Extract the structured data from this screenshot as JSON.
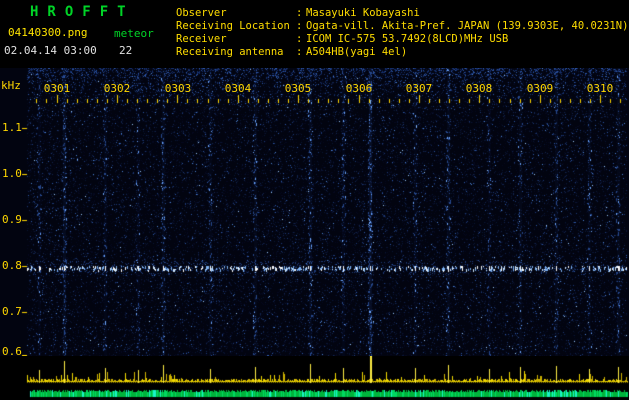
{
  "header": {
    "app_title": "HROFFT",
    "filename": "04140300.png",
    "mode_label": "meteor",
    "datetime": "02.04.14 03:00",
    "echo_count": "22",
    "colon": ":",
    "info_rows": [
      {
        "label": "Observer",
        "value": "Masayuki Kobayashi"
      },
      {
        "label": "Receiving Location",
        "value": "Ogata-vill. Akita-Pref. JAPAN (139.9303E, 40.0231N)"
      },
      {
        "label": "Receiver",
        "value": "ICOM IC-575 53.7492(8LCD)MHz USB"
      },
      {
        "label": "Receiving antenna",
        "value": "A504HB(yagi 4el)"
      }
    ]
  },
  "chart_data": {
    "type": "heatmap",
    "title": "HROFFT meteor radio echo spectrogram",
    "ylabel": "kHz",
    "xtick_labels": [
      "0301",
      "0302",
      "0303",
      "0304",
      "0305",
      "0306",
      "0307",
      "0308",
      "0309",
      "0310"
    ],
    "ytick_labels": [
      "1.1",
      "1.0",
      "0.9",
      "0.8",
      "0.7",
      "0.6"
    ],
    "ylim_khz": [
      0.55,
      1.2
    ],
    "echo_carrier_khz": 0.8,
    "time_window_minutes": 10,
    "events": [
      {
        "t": 0.02,
        "strength": 0.3
      },
      {
        "t": 0.063,
        "strength": 0.7
      },
      {
        "t": 0.13,
        "strength": 0.4
      },
      {
        "t": 0.185,
        "strength": 0.3
      },
      {
        "t": 0.227,
        "strength": 0.5
      },
      {
        "t": 0.305,
        "strength": 0.35
      },
      {
        "t": 0.38,
        "strength": 0.45
      },
      {
        "t": 0.472,
        "strength": 0.55
      },
      {
        "t": 0.528,
        "strength": 0.4
      },
      {
        "t": 0.572,
        "strength": 1.0
      },
      {
        "t": 0.647,
        "strength": 0.4
      },
      {
        "t": 0.702,
        "strength": 0.5
      },
      {
        "t": 0.77,
        "strength": 0.32
      },
      {
        "t": 0.822,
        "strength": 0.42
      },
      {
        "t": 0.882,
        "strength": 0.48
      },
      {
        "t": 0.938,
        "strength": 0.36
      },
      {
        "t": 0.985,
        "strength": 0.45
      }
    ]
  },
  "colors": {
    "background": "#000000",
    "title_green": "#00d427",
    "label_yellow": "#ffd700",
    "info_yellow": "#ffdd00",
    "white_text": "#e2e2e2",
    "noise_blue_bright": "#4e84d8",
    "echo_white": "#cfe8ff",
    "signal_yellow": "#f0d800",
    "level_green": "#00b43c",
    "level_cyan": "#19f5c8"
  }
}
